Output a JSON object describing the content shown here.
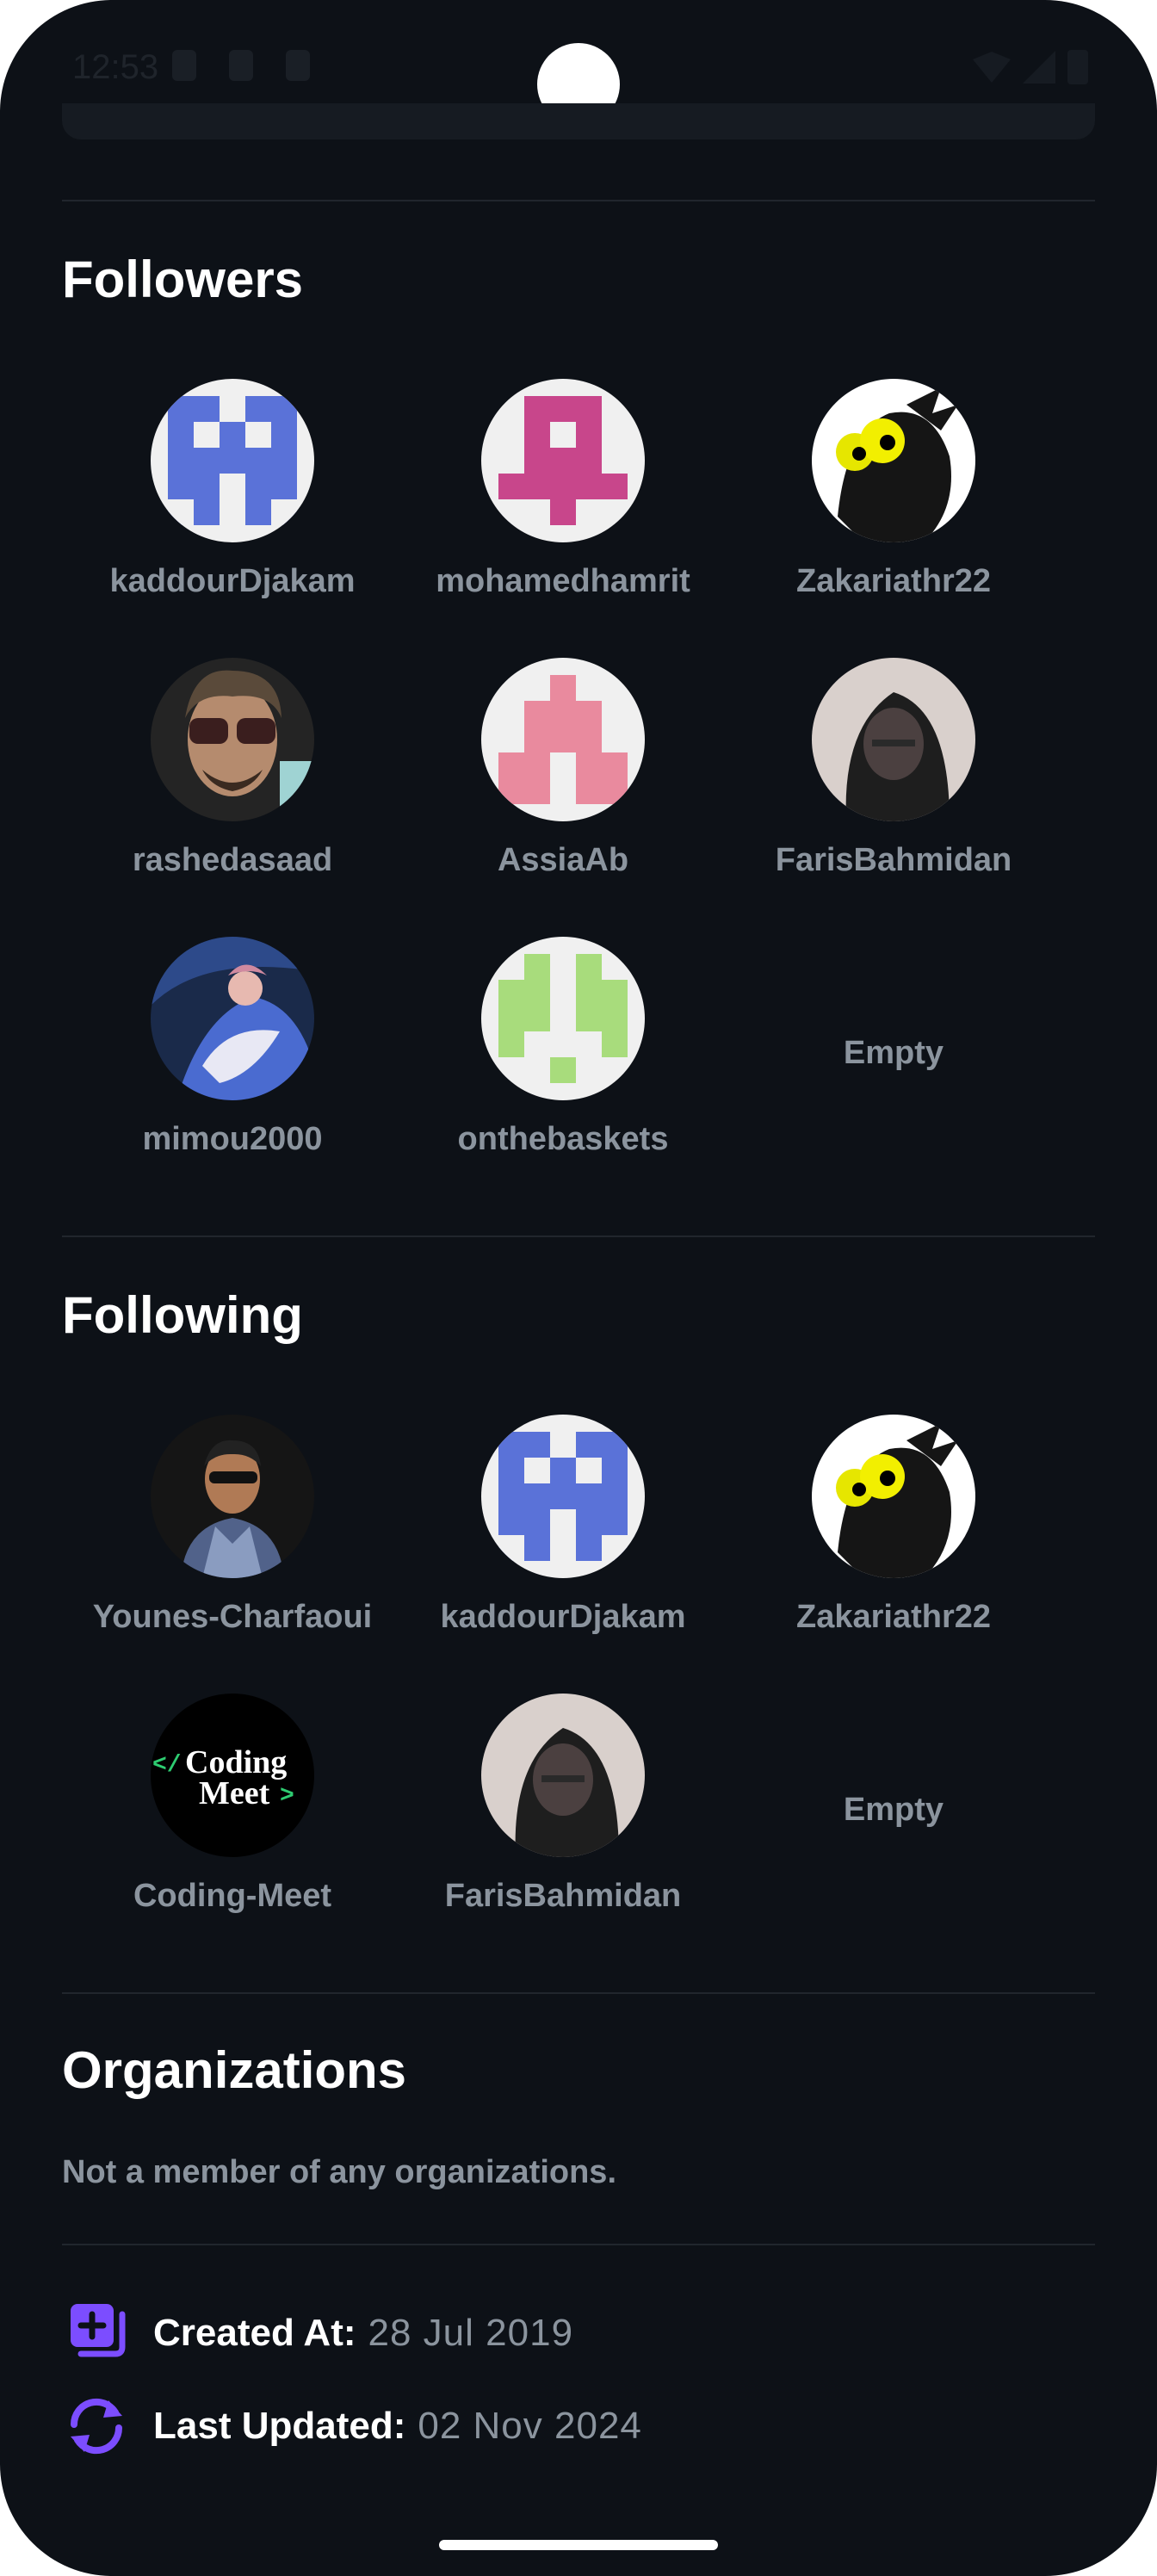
{
  "status_bar": {
    "time": "12:53",
    "icons": [
      "shield-icon",
      "sim-card-icon",
      "font-icon",
      "wifi-icon",
      "signal-icon",
      "battery-icon"
    ]
  },
  "followers": {
    "title": "Followers",
    "users": [
      {
        "name": "kaddourDjakam",
        "avatar": "identicon-blue"
      },
      {
        "name": "mohamedhamrit",
        "avatar": "identicon-pink"
      },
      {
        "name": "Zakariathr22",
        "avatar": "cartoon-creature"
      },
      {
        "name": "rashedasaad",
        "avatar": "photo"
      },
      {
        "name": "AssiaAb",
        "avatar": "identicon-rose"
      },
      {
        "name": "FarisBahmidan",
        "avatar": "photo"
      },
      {
        "name": "mimou2000",
        "avatar": "anime-art"
      },
      {
        "name": "onthebaskets",
        "avatar": "identicon-green"
      }
    ],
    "empty_label": "Empty"
  },
  "following": {
    "title": "Following",
    "users": [
      {
        "name": "Younes-Charfaoui",
        "avatar": "photo"
      },
      {
        "name": "kaddourDjakam",
        "avatar": "identicon-blue"
      },
      {
        "name": "Zakariathr22",
        "avatar": "cartoon-creature"
      },
      {
        "name": "Coding-Meet",
        "avatar": "logo"
      },
      {
        "name": "FarisBahmidan",
        "avatar": "photo"
      }
    ],
    "empty_label": "Empty"
  },
  "organizations": {
    "title": "Organizations",
    "message": "Not a member of any organizations."
  },
  "meta": {
    "created_label": "Created At:",
    "created_value": "28 Jul 2019",
    "updated_label": "Last Updated:",
    "updated_value": "02 Nov 2024"
  },
  "logo_text": {
    "line1": "Coding",
    "line2": "Meet"
  },
  "colors": {
    "background": "#0d1117",
    "text_primary": "#ffffff",
    "text_secondary": "#8b949e",
    "accent": "#7c4dff",
    "identicon_blue": "#5a72d8",
    "identicon_pink": "#c8468b",
    "identicon_rose": "#e98a9e",
    "identicon_green": "#a8dc7c"
  }
}
